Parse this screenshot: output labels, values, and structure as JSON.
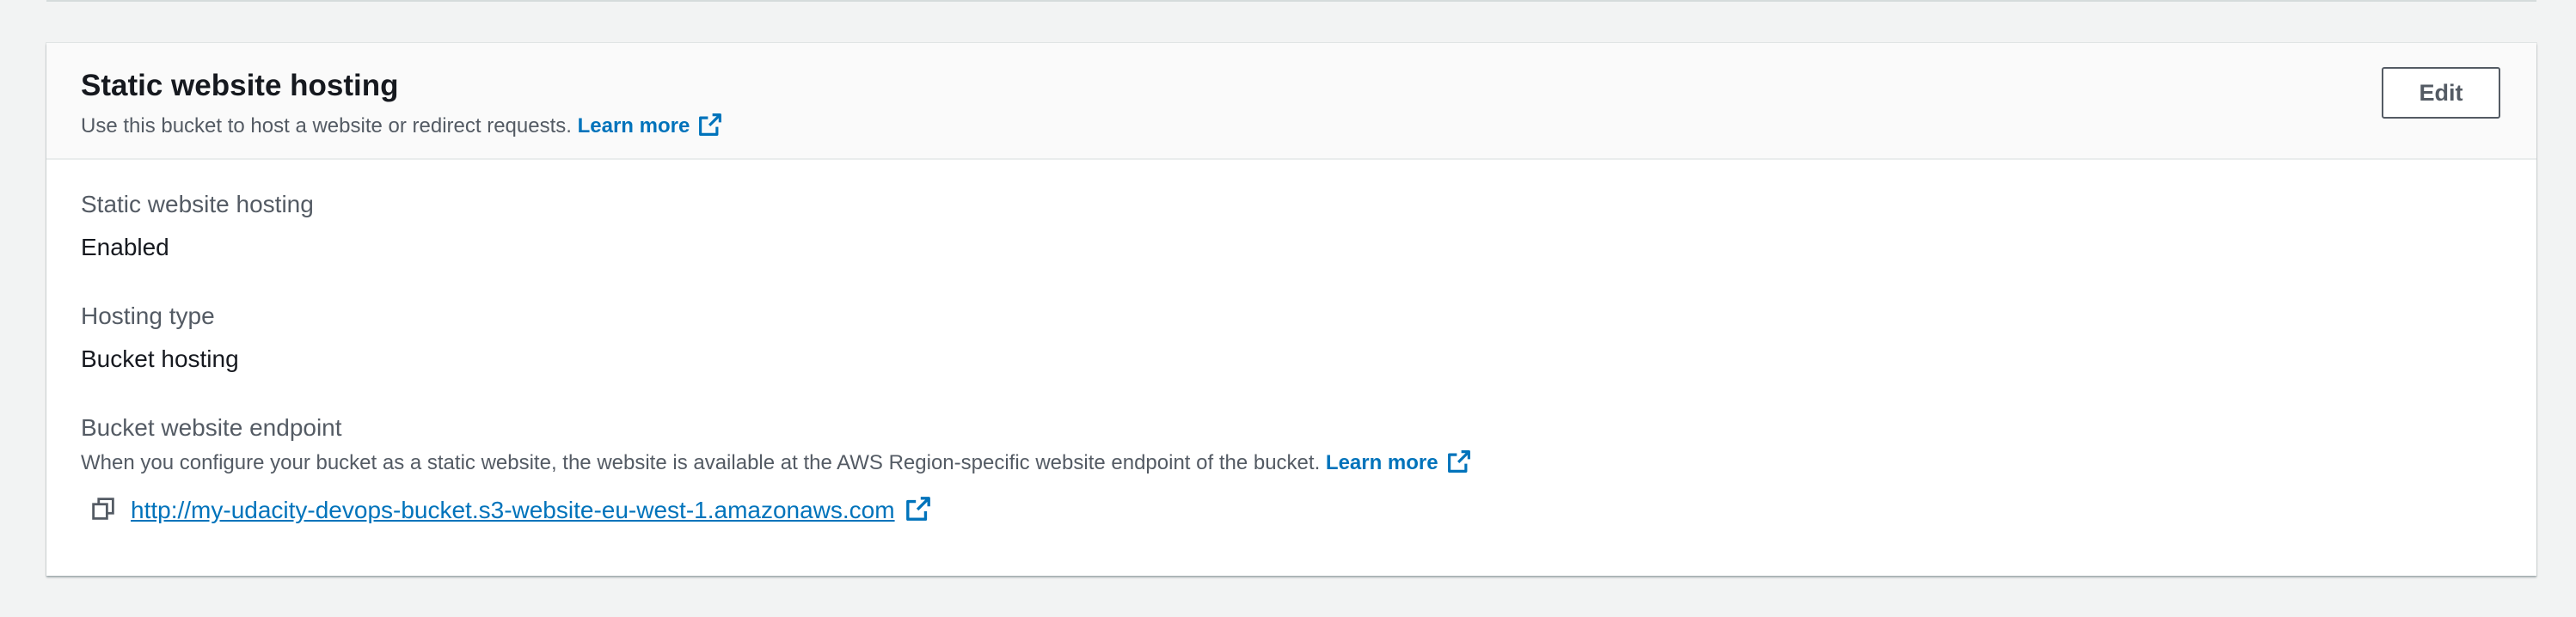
{
  "section": {
    "title": "Static website hosting",
    "description": "Use this bucket to host a website or redirect requests.",
    "learn_more": "Learn more",
    "edit_label": "Edit"
  },
  "fields": {
    "hosting": {
      "label": "Static website hosting",
      "value": "Enabled"
    },
    "hosting_type": {
      "label": "Hosting type",
      "value": "Bucket hosting"
    },
    "endpoint": {
      "label": "Bucket website endpoint",
      "description": "When you configure your bucket as a static website, the website is available at the AWS Region-specific website endpoint of the bucket.",
      "learn_more": "Learn more",
      "url": "http://my-udacity-devops-bucket.s3-website-eu-west-1.amazonaws.com"
    }
  },
  "icons": {
    "external": "external-link-icon",
    "copy": "copy-icon"
  },
  "colors": {
    "link": "#0073bb",
    "label": "#545b64",
    "text": "#16191f",
    "header_bg": "#fafafa",
    "page_bg": "#f2f3f3"
  }
}
